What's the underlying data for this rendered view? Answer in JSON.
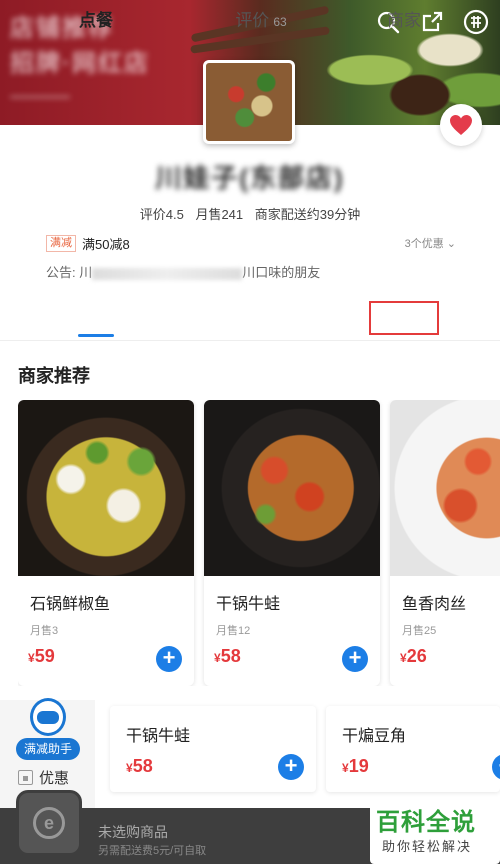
{
  "banner": {
    "blurred_line1": "店铺推荐",
    "blurred_line2": "招牌·网红店"
  },
  "header_icons": [
    "search-icon",
    "share-icon",
    "group-icon"
  ],
  "store": {
    "name": "川娃子(东部店)",
    "rating": "评价4.5",
    "monthly_sales": "月售241",
    "delivery": "商家配送约39分钟"
  },
  "promo": {
    "tag": "满减",
    "text": "满50减8",
    "more": "3个优惠"
  },
  "notice": {
    "prefix": "公告: 川",
    "suffix": "川口味的朋友"
  },
  "tabs": [
    {
      "label": "点餐"
    },
    {
      "label": "评价",
      "count": "63"
    },
    {
      "label": "商家"
    }
  ],
  "recommend": {
    "title": "商家推荐",
    "items": [
      {
        "name": "石锅鲜椒鱼",
        "sold": "月售3",
        "currency": "¥",
        "price": "59"
      },
      {
        "name": "干锅牛蛙",
        "sold": "月售12",
        "currency": "¥",
        "price": "58"
      },
      {
        "name": "鱼香肉丝",
        "sold": "月售25",
        "currency": "¥",
        "price": "26"
      }
    ]
  },
  "assistant": {
    "label": "满减助手"
  },
  "side": {
    "coupon": "优惠"
  },
  "list": [
    {
      "name": "干锅牛蛙",
      "currency": "¥",
      "price": "58"
    },
    {
      "name": "干煸豆角",
      "currency": "¥",
      "price": "19"
    }
  ],
  "cart": {
    "status": "未选购商品",
    "sub": "另需配送费5元/可自取",
    "icon": "e"
  },
  "watermark": {
    "big": "百科全说",
    "small": "助你轻松解决"
  },
  "colors": {
    "accent": "#1c7ee6",
    "price": "#e4393c",
    "highlight_box": "#e43b3b"
  }
}
